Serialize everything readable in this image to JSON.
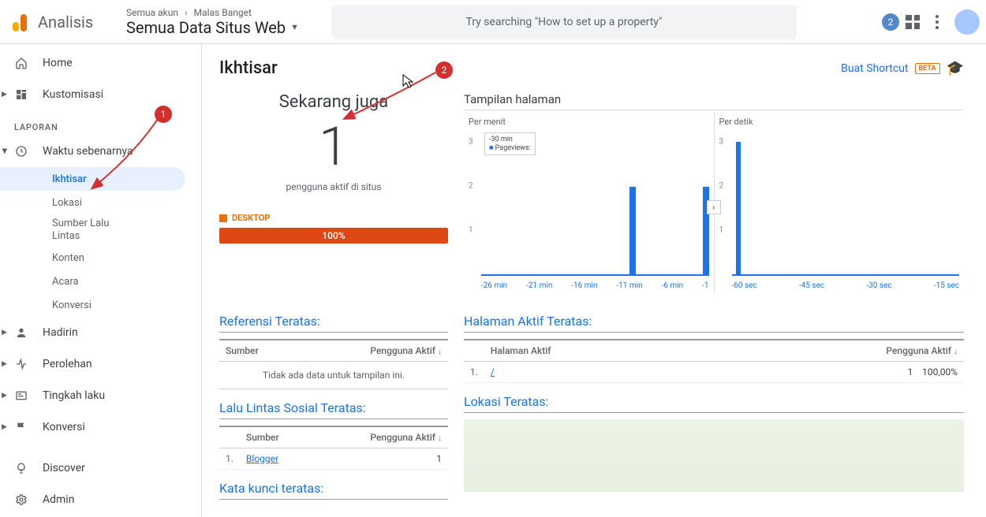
{
  "header": {
    "product": "Analisis",
    "crumb_accounts": "Semua akun",
    "crumb_account_name": "Malas Banget",
    "view_name": "Semua Data Situs Web",
    "search_placeholder": "Try searching \"How to set up a property\"",
    "badge_count": "2"
  },
  "sidebar": {
    "home": "Home",
    "kustom": "Kustomisasi",
    "laporan_heading": "LAPORAN",
    "waktu": "Waktu sebenarnya",
    "sub": {
      "ikhtisar": "Ikhtisar",
      "lokasi": "Lokasi",
      "sumber": "Sumber Lalu Lintas",
      "konten": "Konten",
      "acara": "Acara",
      "konversi": "Konversi"
    },
    "hadirin": "Hadirin",
    "perolehan": "Perolehan",
    "tingkah": "Tingkah laku",
    "konversi2": "Konversi",
    "discover": "Discover",
    "admin": "Admin"
  },
  "annotations": {
    "one": "1",
    "two": "2"
  },
  "page": {
    "title": "Ikhtisar",
    "shortcut": "Buat Shortcut",
    "beta": "BETA"
  },
  "realtime": {
    "now_label": "Sekarang juga",
    "count": "1",
    "active_label": "pengguna aktif di situs",
    "device": "DESKTOP",
    "percent": "100%"
  },
  "pageviews": {
    "title": "Tampilan halaman",
    "per_minute": "Per menit",
    "per_second": "Per detik",
    "legend_time": "-30 min",
    "legend_metric": "Pageviews:"
  },
  "chart_data": [
    {
      "type": "bar",
      "title": "Per menit",
      "categories": [
        "-26 min",
        "-21 min",
        "-16 min",
        "-11 min",
        "-6 min",
        "-1"
      ],
      "values": [
        0,
        0,
        0,
        2,
        0,
        2
      ],
      "ylabel": "",
      "ylim": [
        0,
        3
      ],
      "yticks": [
        1,
        2,
        3
      ]
    },
    {
      "type": "bar",
      "title": "Per detik",
      "categories": [
        "-60 sec",
        "-45 sec",
        "-30 sec",
        "-15 sec"
      ],
      "values": [
        3,
        0,
        0,
        0
      ],
      "ylabel": "",
      "ylim": [
        0,
        3
      ],
      "yticks": [
        1,
        2,
        3
      ]
    }
  ],
  "tables": {
    "referensi": {
      "title": "Referensi Teratas:",
      "col1": "Sumber",
      "col2": "Pengguna Aktif",
      "nodata": "Tidak ada data untuk tampilan ini."
    },
    "halaman_aktif": {
      "title": "Halaman Aktif Teratas:",
      "col1": "Halaman Aktif",
      "col2": "Pengguna Aktif",
      "rows": [
        {
          "idx": "1.",
          "page": "/",
          "users": "1",
          "pct": "100,00%"
        }
      ]
    },
    "sosial": {
      "title": "Lalu Lintas Sosial Teratas:",
      "col1": "Sumber",
      "col2": "Pengguna Aktif",
      "rows": [
        {
          "idx": "1.",
          "source": "Blogger",
          "users": "1"
        }
      ]
    },
    "lokasi": {
      "title": "Lokasi Teratas:"
    },
    "keyword": {
      "title": "Kata kunci teratas:"
    }
  }
}
